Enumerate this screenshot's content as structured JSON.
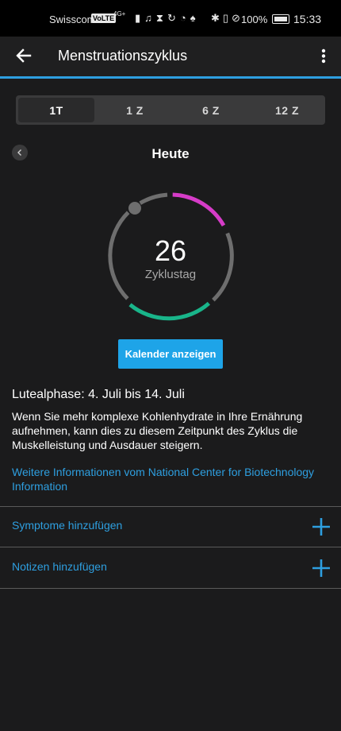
{
  "status_bar": {
    "carrier": "Swisscom",
    "volte": "VoLTE",
    "network": "4G+",
    "battery": "100%",
    "time": "15:33"
  },
  "app_bar": {
    "title": "Menstruationszyklus",
    "back_icon": "arrow-left-icon",
    "menu_icon": "more-vert-icon"
  },
  "tabs": [
    {
      "label": "1T",
      "active": true
    },
    {
      "label": "1 Z",
      "active": false
    },
    {
      "label": "6 Z",
      "active": false
    },
    {
      "label": "12 Z",
      "active": false
    }
  ],
  "date_nav": {
    "label": "Heute",
    "prev_icon": "chevron-left-icon"
  },
  "cycle": {
    "day": "26",
    "day_label": "Zyklustag",
    "colors": {
      "track": "#6e6e6e",
      "period": "#d63cc8",
      "fertile": "#19b58a",
      "marker": "#6e6e6e"
    }
  },
  "calendar_button": {
    "label": "Kalender anzeigen"
  },
  "phase": {
    "title": "Lutealphase: 4. Juli bis 14. Juli",
    "text": "Wenn Sie mehr komplexe Kohlenhydrate in Ihre Ernährung aufnehmen, kann dies zu diesem Zeitpunkt des Zyklus die Muskelleistung und Ausdauer steigern.",
    "link": "Weitere Informationen vom National Center for Biotechnology Information"
  },
  "actions": [
    {
      "label": "Symptome hinzufügen",
      "icon": "plus-icon"
    },
    {
      "label": "Notizen hinzufügen",
      "icon": "plus-icon"
    }
  ],
  "colors": {
    "accent": "#2e9fe0",
    "button": "#1ea4e8",
    "background": "#1b1b1c"
  }
}
